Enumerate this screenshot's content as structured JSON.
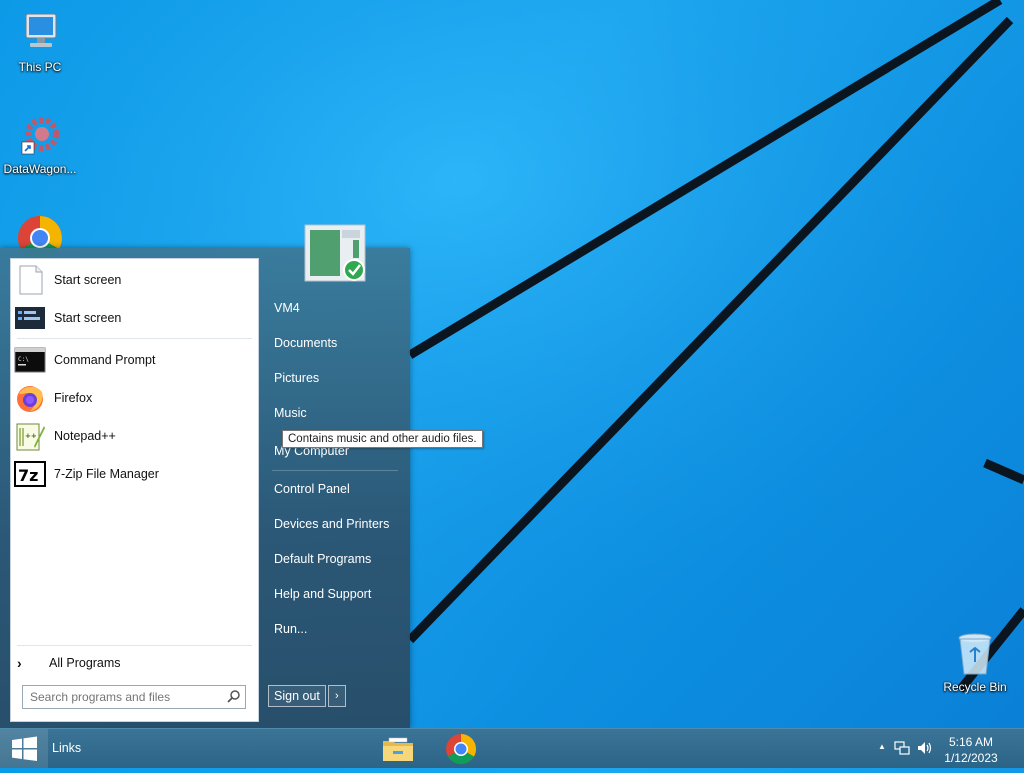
{
  "desktop": {
    "icons": [
      {
        "label": "This PC",
        "icon": "computer-icon"
      },
      {
        "label": "DataWagon...",
        "icon": "gear-shortcut-icon"
      },
      {
        "label": "",
        "icon": "chrome-icon"
      },
      {
        "label": "Recycle Bin",
        "icon": "recycle-bin-icon"
      }
    ]
  },
  "start_menu": {
    "programs": [
      {
        "label": "Start screen",
        "icon": "blank-document-icon"
      },
      {
        "label": "Start screen",
        "icon": "start-screen-icon"
      },
      {
        "label": "Command Prompt",
        "icon": "command-prompt-icon"
      },
      {
        "label": "Firefox",
        "icon": "firefox-icon"
      },
      {
        "label": "Notepad++",
        "icon": "notepadpp-icon"
      },
      {
        "label": "7-Zip File Manager",
        "icon": "7zip-icon"
      }
    ],
    "all_programs": "All Programs",
    "search_placeholder": "Search programs and files",
    "right_links": [
      {
        "label": "VM4"
      },
      {
        "label": "Documents"
      },
      {
        "label": "Pictures"
      },
      {
        "label": "Music"
      },
      {
        "label": "My Computer"
      },
      {
        "label": "Control Panel"
      },
      {
        "label": "Devices and Printers"
      },
      {
        "label": "Default Programs"
      },
      {
        "label": "Help and Support"
      },
      {
        "label": "Run..."
      }
    ],
    "sign_out": "Sign out",
    "sign_out_arrow": "›",
    "tooltip": "Contains music and other audio files."
  },
  "taskbar": {
    "toolbar_label": "Links",
    "apps": [
      {
        "icon": "file-explorer-icon"
      },
      {
        "icon": "chrome-icon"
      }
    ],
    "tray": {
      "show_hidden": "▲",
      "time": "5:16 AM",
      "date": "1/12/2023"
    }
  },
  "colors": {
    "wallpaper": "#1aa7f0",
    "taskbar": "#2f6a8c",
    "start_menu": "#2f5c7c"
  }
}
